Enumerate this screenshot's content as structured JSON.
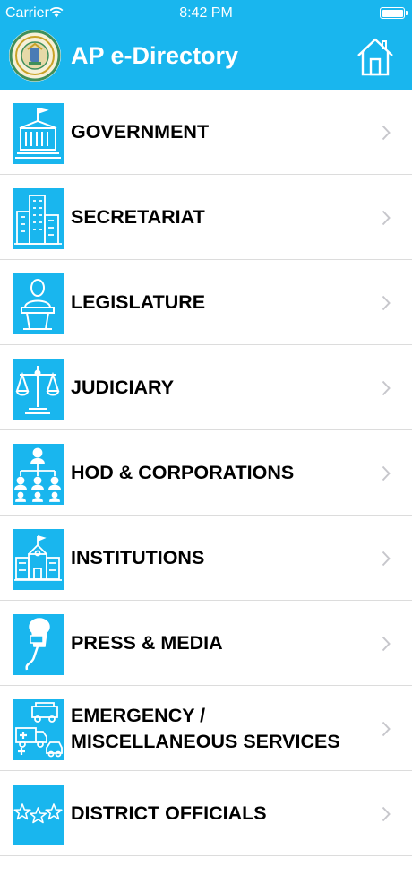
{
  "status_bar": {
    "carrier": "Carrier",
    "time": "8:42 PM"
  },
  "header": {
    "title": "AP e-Directory",
    "logo": "ap-emblem-logo",
    "home_icon": "home-icon"
  },
  "theme": {
    "accent": "#19b6ee"
  },
  "menu": [
    {
      "label": "GOVERNMENT",
      "icon": "government-building-icon"
    },
    {
      "label": "SECRETARIAT",
      "icon": "secretariat-building-icon"
    },
    {
      "label": "LEGISLATURE",
      "icon": "speaker-podium-icon"
    },
    {
      "label": "JUDICIARY",
      "icon": "scales-of-justice-icon"
    },
    {
      "label": "HOD & CORPORATIONS",
      "icon": "org-chart-icon"
    },
    {
      "label": "INSTITUTIONS",
      "icon": "school-building-icon"
    },
    {
      "label": "PRESS & MEDIA",
      "icon": "microphone-icon"
    },
    {
      "label": "EMERGENCY / MISCELLANEOUS SERVICES",
      "icon": "emergency-vehicles-icon"
    },
    {
      "label": "DISTRICT OFFICIALS",
      "icon": "stars-icon"
    }
  ]
}
